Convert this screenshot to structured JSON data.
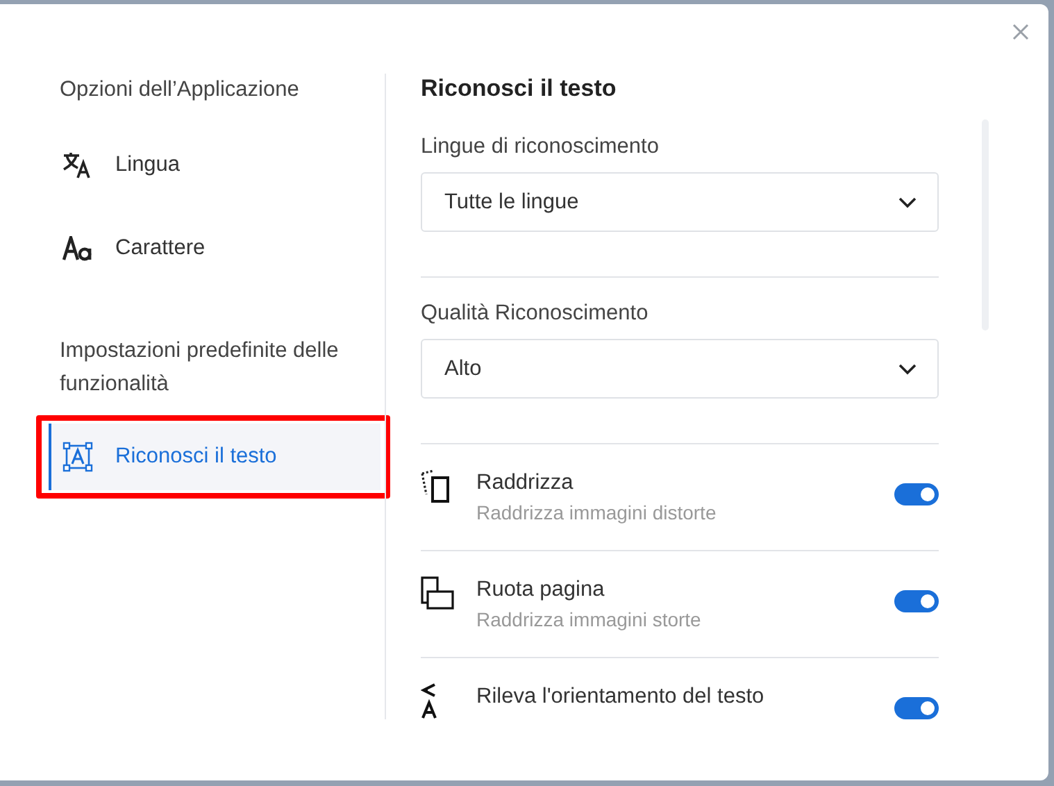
{
  "sidebar": {
    "sections": [
      {
        "title": "Opzioni dell’Applicazione",
        "items": [
          {
            "label": "Lingua",
            "selected": false
          },
          {
            "label": "Carattere",
            "selected": false
          }
        ]
      },
      {
        "title": "Impostazioni predefinite delle funzionalità",
        "items": [
          {
            "label": "Riconosci il testo",
            "selected": true
          }
        ]
      }
    ]
  },
  "panel": {
    "title": "Riconosci il testo",
    "selects": [
      {
        "label": "Lingue di riconoscimento",
        "value": "Tutte le lingue"
      },
      {
        "label": "Qualità Riconoscimento",
        "value": "Alto"
      }
    ],
    "options": [
      {
        "title": "Raddrizza",
        "subtitle": "Raddrizza immagini distorte",
        "on": true
      },
      {
        "title": "Ruota pagina",
        "subtitle": "Raddrizza immagini storte",
        "on": true
      },
      {
        "title": "Rileva l'orientamento del testo",
        "on": true
      }
    ]
  }
}
